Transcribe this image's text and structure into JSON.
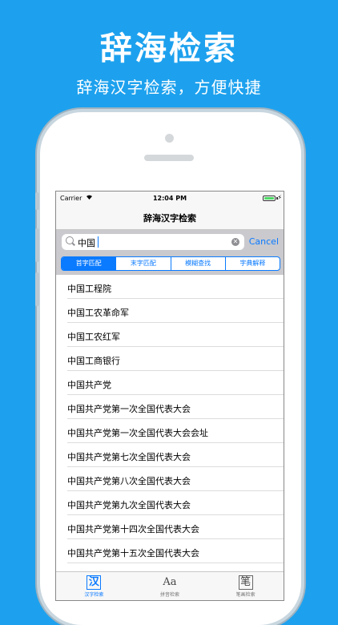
{
  "promo": {
    "title": "辞海检索",
    "subtitle": "辞海汉字检索，方便快捷"
  },
  "status_bar": {
    "carrier": "Carrier",
    "time": "12:04 PM",
    "battery_level": 1.0
  },
  "nav": {
    "title": "辞海汉字检索"
  },
  "search": {
    "value": "中国",
    "cancel_label": "Cancel"
  },
  "segments": [
    {
      "label": "首字匹配",
      "active": true
    },
    {
      "label": "末字匹配",
      "active": false
    },
    {
      "label": "模糊查找",
      "active": false
    },
    {
      "label": "字典解释",
      "active": false
    }
  ],
  "results": [
    "中国工程院",
    "中国工农革命军",
    "中国工农红军",
    "中国工商银行",
    "中国共产党",
    "中国共产党第一次全国代表大会",
    "中国共产党第一次全国代表大会会址",
    "中国共产党第七次全国代表大会",
    "中国共产党第八次全国代表大会",
    "中国共产党第九次全国代表大会",
    "中国共产党第十四次全国代表大会",
    "中国共产党第十五次全国代表大会"
  ],
  "tabs": [
    {
      "glyph": "汉",
      "label": "汉字检索",
      "icon": "han-character-icon",
      "active": true
    },
    {
      "glyph": "Aa",
      "label": "拼音检索",
      "icon": "pinyin-icon",
      "active": false
    },
    {
      "glyph": "笔",
      "label": "笔画检索",
      "icon": "stroke-icon",
      "active": false
    }
  ],
  "colors": {
    "background": "#1da1ee",
    "accent": "#0a7aff"
  }
}
